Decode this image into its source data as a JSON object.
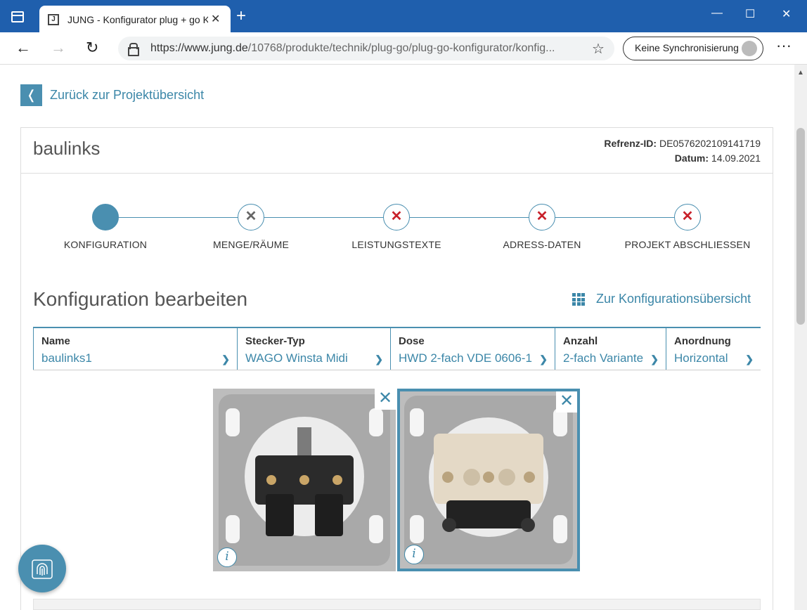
{
  "browser": {
    "tab_title": "JUNG - Konfigurator plug + go K",
    "new_tab": "+",
    "tab_close": "✕",
    "url_host": "https://www.jung.de",
    "url_path": "/10768/produkte/technik/plug-go/plug-go-konfigurator/konfig...",
    "sync_label": "Keine Synchronisierung",
    "minimize": "—",
    "maximize": "☐",
    "close": "✕",
    "back": "←",
    "forward": "→",
    "reload": "↻",
    "favorite": "☆",
    "menu": "···",
    "favicon": "J"
  },
  "page": {
    "back_icon": "❬",
    "back_link": "Zurück zur Projektübersicht",
    "project_name": "baulinks",
    "ref_label": "Refrenz-ID:",
    "ref_value": "DE0576202109141719",
    "date_label": "Datum:",
    "date_value": "14.09.2021",
    "steps": [
      {
        "label": "KONFIGURATION",
        "state": "active",
        "mark": ""
      },
      {
        "label": "MENGE/RÄUME",
        "state": "grey",
        "mark": "✕"
      },
      {
        "label": "LEISTUNGSTEXTE",
        "state": "red",
        "mark": "✕"
      },
      {
        "label": "ADRESS-DATEN",
        "state": "red",
        "mark": "✕"
      },
      {
        "label": "PROJEKT ABSCHLIESSEN",
        "state": "red",
        "mark": "✕"
      }
    ],
    "section_title": "Konfiguration bearbeiten",
    "overview_link": "Zur Konfigurationsübersicht",
    "columns": [
      {
        "header": "Name",
        "value": "baulinks1"
      },
      {
        "header": "Stecker-Typ",
        "value": "WAGO Winsta Midi"
      },
      {
        "header": "Dose",
        "value": "HWD 2-fach VDE 0606-1"
      },
      {
        "header": "Anzahl",
        "value": "2-fach Variante"
      },
      {
        "header": "Anordnung",
        "value": "Horizontal"
      }
    ],
    "chevron": "❯",
    "product_close": "✕",
    "product_info": "i"
  },
  "colors": {
    "accent": "#4a8fb0",
    "link": "#3c87a8",
    "error": "#c8202a",
    "chrome": "#1f5fad"
  }
}
